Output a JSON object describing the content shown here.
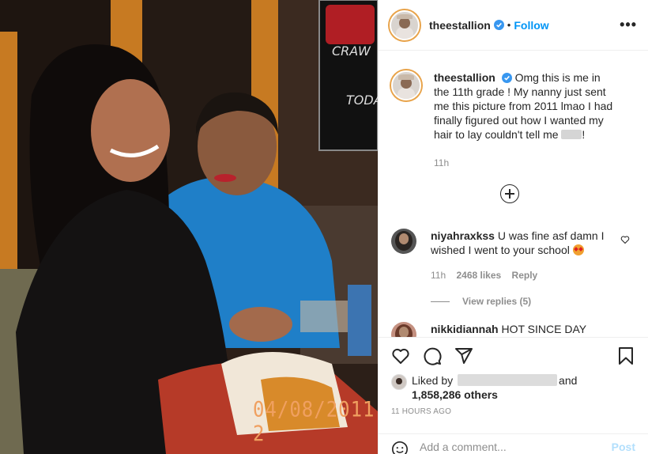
{
  "post": {
    "username": "theestallion",
    "follow_label": "Follow",
    "separator": "•",
    "more_label": "•••",
    "photo_date_stamp": "04/08/2011  2"
  },
  "caption": {
    "username": "theestallion",
    "text": "Omg this is me in the 11th grade ! My nanny just sent me this picture from 2011 lmao I had finally figured out how I wanted my hair to lay couldn't tell me",
    "text_end": "!",
    "time": "11h"
  },
  "comments": [
    {
      "username": "niyahraxkss",
      "text": "U was fine asf damn I wished I went to your school",
      "time": "11h",
      "likes": "2468 likes",
      "reply_label": "Reply",
      "view_replies": "View replies (5)"
    },
    {
      "username": "nikkidiannah",
      "text": "HOT SINCE DAY"
    }
  ],
  "likes": {
    "liked_by_prefix": "Liked by",
    "and": "and",
    "others": "1,858,286 others",
    "timestamp": "11 HOURS AGO"
  },
  "add_comment": {
    "placeholder": "Add a comment...",
    "post_label": "Post"
  },
  "colors": {
    "accent": "#0095f6",
    "post_disabled": "#b2dffc",
    "verified": "#3897f0"
  },
  "icons": [
    "verified-badge-icon",
    "more-options-icon",
    "add-circle-icon",
    "heart-icon",
    "comment-icon",
    "share-icon",
    "bookmark-icon",
    "emoji-icon"
  ]
}
